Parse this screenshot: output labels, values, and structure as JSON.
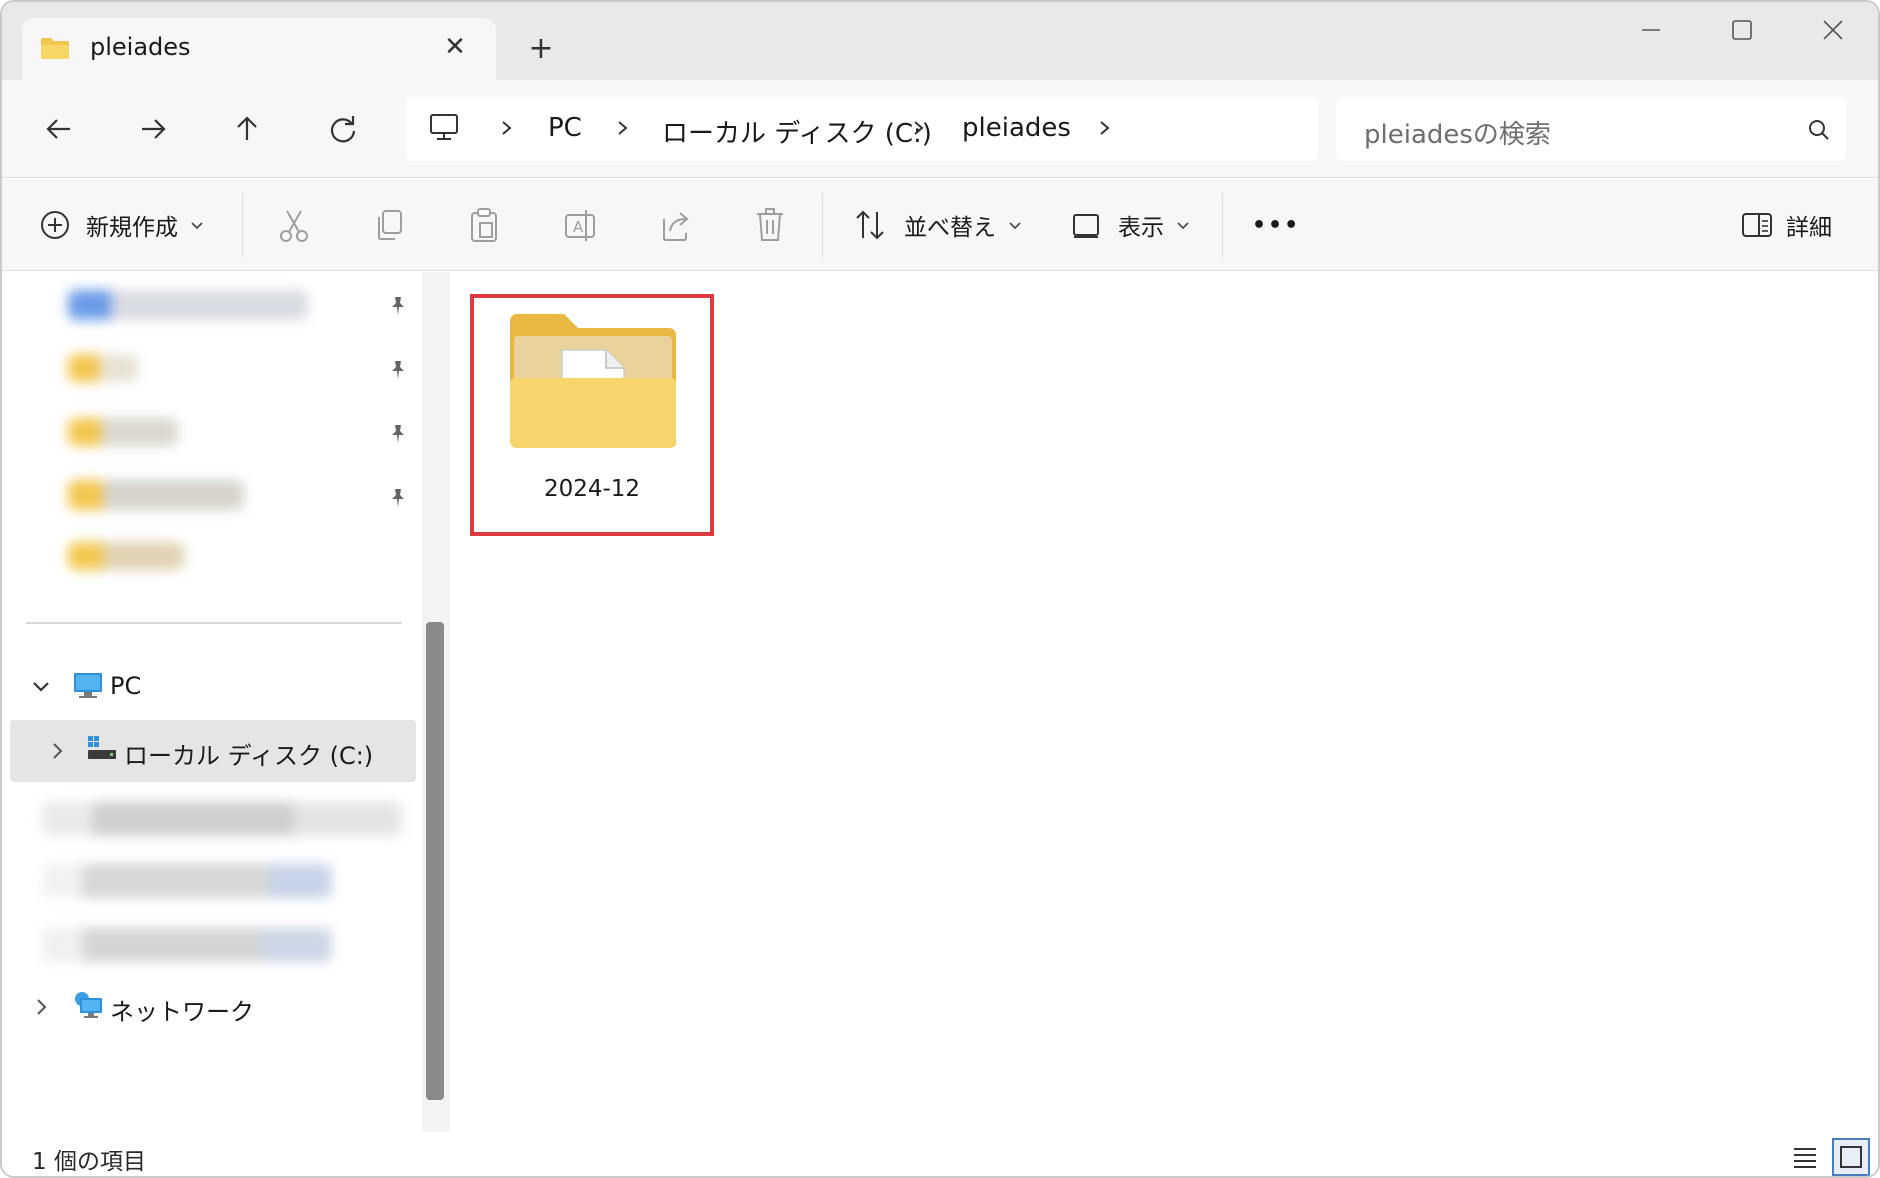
{
  "window": {
    "tab_title": "pleiades",
    "new_tab": "+",
    "tab_close": "✕"
  },
  "nav": {
    "breadcrumb": [
      "PC",
      "ローカル ディスク (C:)",
      "pleiades"
    ],
    "search_placeholder": "pleiadesの検索"
  },
  "toolbar": {
    "new_label": "新規作成",
    "sort_label": "並べ替え",
    "view_label": "表示",
    "more_label": "•••",
    "details_label": "詳細"
  },
  "sidebar": {
    "pc_label": "PC",
    "local_disk_label": "ローカル ディスク (C:)",
    "network_label": "ネットワーク"
  },
  "content": {
    "items": [
      {
        "name": "2024-12"
      }
    ]
  },
  "status": {
    "item_count": "1 個の項目"
  },
  "colors": {
    "accent_folder": "#f3c74f",
    "selection_border": "#e0393f",
    "selected_row": "#e5e5e5"
  }
}
